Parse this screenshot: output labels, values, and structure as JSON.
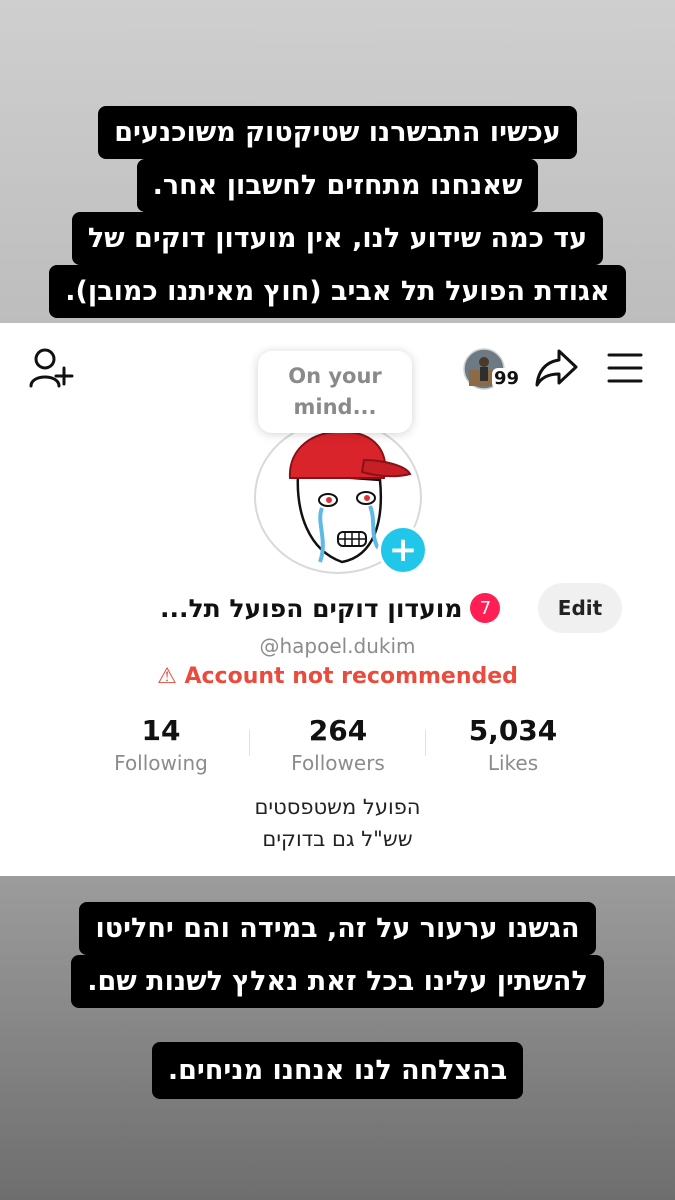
{
  "caption_top": {
    "lines": [
      "עכשיו התבשרנו שטיקטוק משוכנעים",
      "שאנחנו מתחזים לחשבון אחר.",
      "עד כמה שידוע לנו, אין מועדון דוקים של",
      "אגודת הפועל תל אביב (חוץ מאיתנו כמובן)."
    ]
  },
  "profile": {
    "add_friend_icon": "person-plus-icon",
    "share_icon": "share-arrow-icon",
    "menu_icon": "hamburger-menu-icon",
    "story_count": "99",
    "bubble_text": "On your mind...",
    "name": "מועדון דוקים הפועל תל...",
    "notification_count": "7",
    "edit_label": "Edit",
    "handle": "@hapoel.dukim",
    "warning_text": "Account not recommended",
    "stats": {
      "following": {
        "value": "14",
        "label": "Following"
      },
      "followers": {
        "value": "264",
        "label": "Followers"
      },
      "likes": {
        "value": "5,034",
        "label": "Likes"
      }
    },
    "bio": [
      "הפועל משטפסטים",
      "שש\"ל גם בדוקים"
    ]
  },
  "caption_bottom": {
    "lines": [
      "הגשנו ערעור על זה, במידה והם יחליטו",
      "להשתין עלינו בכל זאת נאלץ לשנות שם."
    ],
    "closing": "בהצלחה לנו אנחנו מניחים."
  },
  "colors": {
    "warning": "#ea4b3c",
    "badge_pink": "#ff1f55",
    "plus_cyan": "#20c7e8",
    "hat_red": "#d9242b"
  }
}
